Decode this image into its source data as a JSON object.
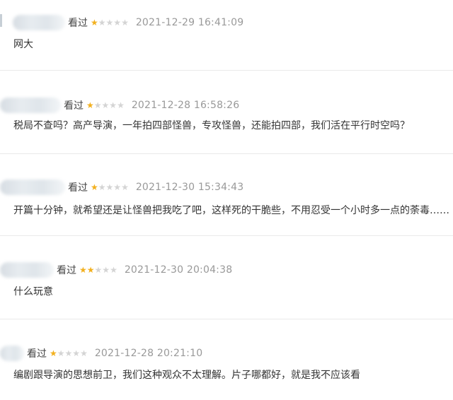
{
  "comments": [
    {
      "action": "看过",
      "rating": 1,
      "time": "2021-12-29 16:41:09",
      "text": "网大"
    },
    {
      "action": "看过",
      "rating": 1,
      "time": "2021-12-28 16:58:26",
      "text": "税局不查吗？高产导演，一年拍四部怪兽，专攻怪兽，还能拍四部，我们活在平行时空吗？"
    },
    {
      "action": "看过",
      "rating": 1,
      "time": "2021-12-30 15:34:43",
      "text": "开篇十分钟，就希望还是让怪兽把我吃了吧，这样死的干脆些，不用忍受一个小时多一点的荼毒……"
    },
    {
      "action": "看过",
      "rating": 2,
      "time": "2021-12-30 20:04:38",
      "text": "什么玩意"
    },
    {
      "action": "看过",
      "rating": 1,
      "time": "2021-12-28 20:21:10",
      "text": "编剧跟导演的思想前卫，我们这种观众不太理解。片子哪都好，就是我不应该看"
    }
  ],
  "star_colors": {
    "on": "#f2b01e",
    "off": "#d4d4d4"
  }
}
